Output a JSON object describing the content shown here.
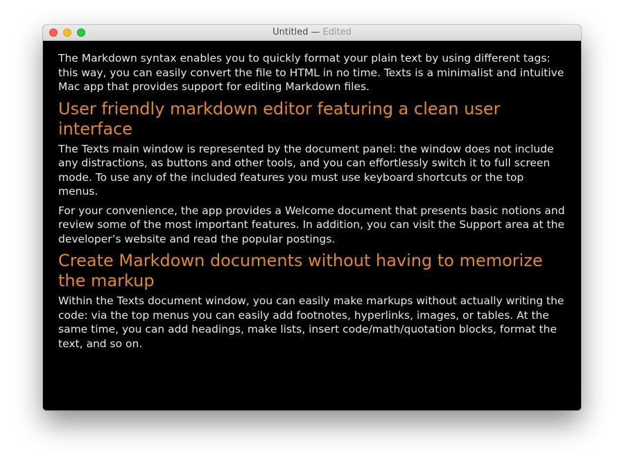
{
  "window": {
    "title": "Untitled",
    "separator": "—",
    "status": "Edited"
  },
  "document": {
    "p1": "The Markdown syntax enables you to quickly format your plain text by using different tags: this way, you can easily convert the file to HTML in no time. Texts is a minimalist and intuitive Mac app that provides support for editing Markdown files.",
    "h1": "User friendly markdown editor featuring a clean user interface",
    "p2": "The Texts main window is represented by the document panel: the window does not include any distractions, as buttons and other tools, and you can effortlessly switch it to full screen mode. To use any of the included features you must use keyboard shortcuts or the top menus.",
    "p3": "For your convenience, the app provides a Welcome document that presents basic notions and review some of the most important features. In addition, you can visit the Support area at the developer’s website and read the popular postings.",
    "h2": "Create Markdown documents without having to memorize the markup",
    "p4": "Within the Texts document window, you can easily make markups without actually writing the code: via the top menus you can easily add footnotes, hyperlinks, images, or tables. At the same time, you can add headings, make lists, insert code/math/quotation blocks, format the text, and so on."
  },
  "colors": {
    "heading": "#e0892a",
    "body_text": "#e8e8e8",
    "background": "#000000",
    "close": "#fc5f57",
    "minimize": "#fdbc2e",
    "zoom": "#29c940"
  },
  "icons": {
    "close": "close-button-icon",
    "minimize": "minimize-button-icon",
    "zoom": "zoom-button-icon"
  }
}
